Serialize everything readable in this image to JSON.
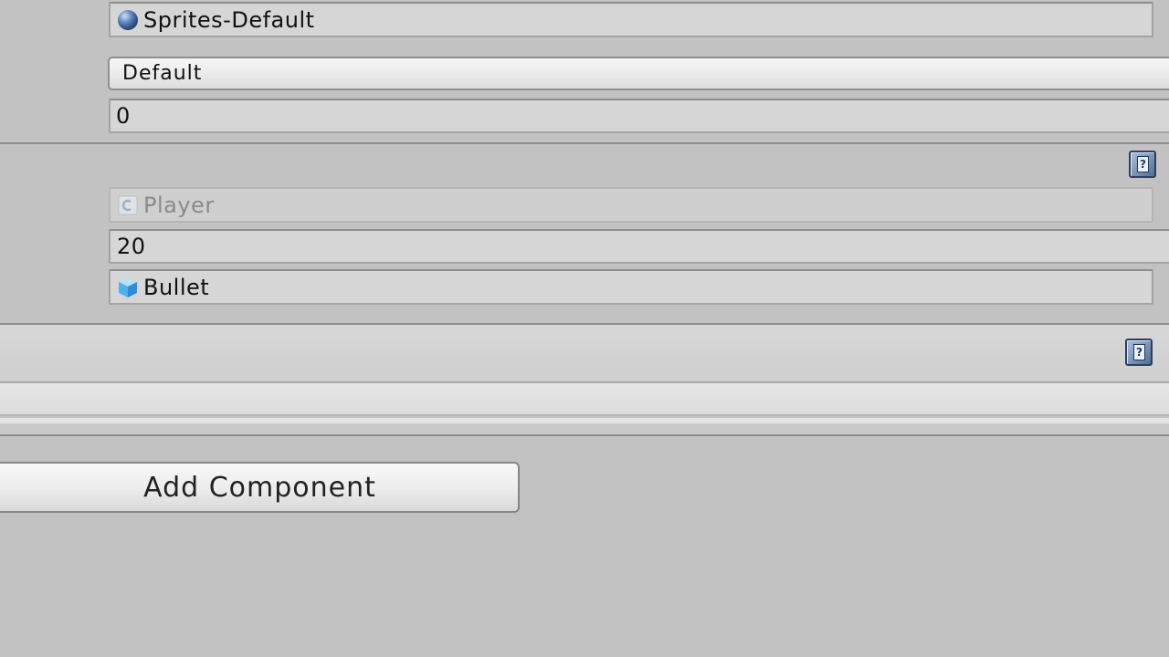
{
  "sprite_renderer": {
    "material": {
      "value": "Sprites-Default",
      "icon": "material-sphere-icon"
    },
    "sorting_layer": {
      "value": "Default"
    },
    "order_in_layer": {
      "value": "0"
    }
  },
  "script_component": {
    "script": {
      "value": "Player",
      "icon": "csharp-script-icon"
    },
    "speed": {
      "value": "20"
    },
    "bullet": {
      "value": "Bullet",
      "icon": "prefab-cube-icon"
    },
    "help_icon": "help-book-icon"
  },
  "collapsed_component": {
    "help_icon": "help-book-icon"
  },
  "add_component_label": "Add Component"
}
